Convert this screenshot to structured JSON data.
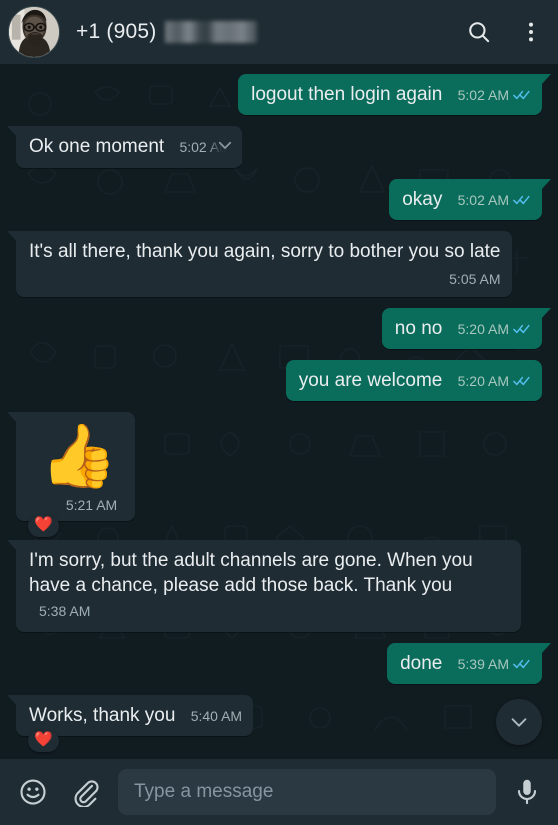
{
  "header": {
    "contact_name": "+1 (905)",
    "redacted_suffix": true,
    "avatar_alt": "contact-photo",
    "search_icon": "search-icon",
    "menu_icon": "overflow-menu-icon"
  },
  "messages": [
    {
      "id": "m1",
      "direction": "out",
      "text": "logout then login again",
      "time": "5:02 AM",
      "status": "read",
      "tail": true,
      "meta_inline": true
    },
    {
      "id": "m2",
      "direction": "in",
      "text": "Ok one moment",
      "time": "5:02 AM",
      "status": "none",
      "tail": true,
      "meta_inline": true,
      "menu_open": true
    },
    {
      "id": "m3",
      "direction": "out",
      "text": "okay",
      "time": "5:02 AM",
      "status": "read",
      "tail": true,
      "meta_inline": true
    },
    {
      "id": "m4",
      "direction": "in",
      "text": "It's all there, thank you again, sorry to bother you so late",
      "time": "5:05 AM",
      "status": "none",
      "tail": true,
      "meta_inline": false
    },
    {
      "id": "m5",
      "direction": "out",
      "text": "no no",
      "time": "5:20 AM",
      "status": "read",
      "tail": true,
      "meta_inline": true
    },
    {
      "id": "m6",
      "direction": "out",
      "text": "you are welcome",
      "time": "5:20 AM",
      "status": "read",
      "tail": false,
      "meta_inline": true
    },
    {
      "id": "m7",
      "direction": "in",
      "emoji": "👍",
      "text": "",
      "time": "5:21 AM",
      "status": "none",
      "tail": true,
      "meta_inline": false,
      "emoji_only": true,
      "reaction": "❤️"
    },
    {
      "id": "m8",
      "direction": "in",
      "text": "I'm sorry, but the adult channels are gone. When you have a chance, please add those back. Thank you",
      "time": "5:38 AM",
      "status": "none",
      "tail": true,
      "meta_inline": true
    },
    {
      "id": "m9",
      "direction": "out",
      "text": "done",
      "time": "5:39 AM",
      "status": "read",
      "tail": true,
      "meta_inline": true
    },
    {
      "id": "m10",
      "direction": "in",
      "text": "Works, thank you",
      "time": "5:40 AM",
      "status": "none",
      "tail": true,
      "meta_inline": true,
      "reaction": "❤️"
    }
  ],
  "scroll_button": {
    "icon": "chevron-down-icon"
  },
  "composer": {
    "emoji_icon": "emoji-smiley-icon",
    "attach_icon": "paperclip-icon",
    "input_value": "",
    "input_placeholder": "Type a message",
    "mic_icon": "microphone-icon"
  },
  "colors": {
    "outgoing_bubble": "#0a6c5a",
    "incoming_bubble": "#1f2c33",
    "chat_background": "#111c21",
    "header_background": "#1f2c33",
    "read_tick": "#53bdeb",
    "text_primary": "#e9edef",
    "text_meta": "#9fb0b5"
  }
}
